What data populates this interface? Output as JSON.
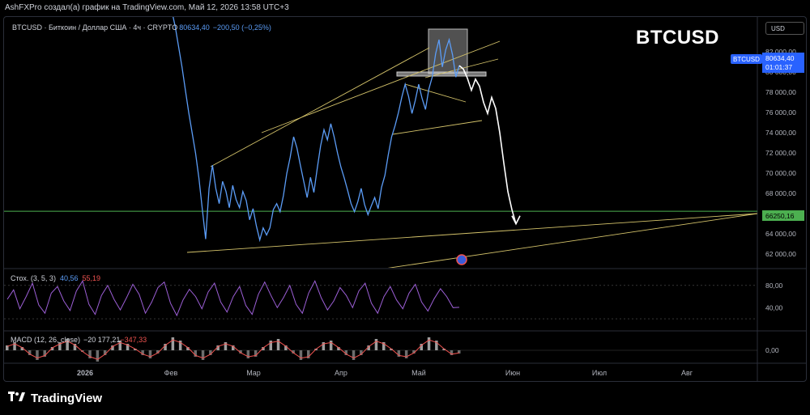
{
  "header": {
    "attribution": "AshFXPro создал(а) график на TradingView.com, Май 12, 2026 13:58 UTC+3"
  },
  "symbol": {
    "line": "BTCUSD · Биткоин / Доллар США · 4ч · CRYPTO",
    "value": "80634,40",
    "change": "−200,50 (−0,25%)",
    "big_label": "BTCUSD",
    "currency": "USD",
    "tag": "BTCUSD",
    "last_price": "80634,40",
    "countdown": "01:01:37",
    "level_label": "66250,16"
  },
  "indicators": {
    "stoch": {
      "name": "Стох. (3, 5, 3)",
      "k": "40,56",
      "d": "55,19"
    },
    "macd": {
      "name": "MACD (12, 26, close)",
      "values": "−20 177,21",
      "hist": "−347,33"
    }
  },
  "footer": {
    "brand": "TradingView"
  },
  "colors": {
    "price_line": "#5b9cf6",
    "trend_lines": "#d4c36a",
    "level": "#4caf50",
    "stoch_k": "#9c5fd6",
    "macd_hist": "#9e9e9e",
    "forecast": "#ffffff"
  },
  "chart_data": [
    {
      "type": "line",
      "title": "BTCUSD",
      "x_ticks": [
        "2026",
        "Фев",
        "Мар",
        "Апр",
        "Май",
        "Июн",
        "Июл",
        "Авг"
      ],
      "y_ticks": [
        62000,
        64000,
        66000,
        68000,
        70000,
        72000,
        74000,
        76000,
        78000,
        80000,
        82000
      ],
      "y_tick_labels": [
        "62 000,00",
        "64 000,00",
        "66 000,00",
        "68 000,00",
        "70 000,00",
        "72 000,00",
        "74 000,00",
        "76 000,00",
        "78 000,00",
        "80 000,00",
        "82 000,00"
      ],
      "ylim": [
        61300,
        84000
      ],
      "series": [
        {
          "values": [
            87800,
            86000,
            84500,
            82500,
            80500,
            78200,
            76000,
            74000,
            72000,
            69500,
            66500,
            63500,
            68500,
            70800,
            68500,
            67000,
            69200,
            68200,
            66600,
            68800,
            67400,
            66600,
            68200,
            67300,
            65400,
            66500,
            64800,
            63400,
            64600,
            63900,
            64600,
            66400,
            67000,
            66200,
            67800,
            70000,
            71600,
            73600,
            72500,
            70800,
            69200,
            67600,
            69600,
            68100,
            70500,
            72700,
            74300,
            73300,
            74900,
            73600,
            72000,
            70600,
            69500,
            68300,
            67000,
            66200,
            67200,
            68500,
            66900,
            65900,
            66800,
            67600,
            66500,
            68600,
            69800,
            71800,
            73600,
            74700,
            76000,
            77500,
            78800,
            77600,
            75900,
            77200,
            78800,
            77400,
            76300,
            78300,
            79500,
            81800,
            83200,
            80500,
            82200,
            83200,
            81700,
            79500,
            80634
          ]
        }
      ],
      "forecast": [
        80634,
        80300,
        79400,
        78200,
        79300,
        78600,
        77000,
        75900,
        77500,
        76400,
        74000,
        71000,
        68200,
        66400,
        65000
      ]
    },
    {
      "type": "line",
      "title": "Стох. (3, 5, 3)",
      "y_ticks": [
        40,
        80
      ],
      "y_tick_labels": [
        "40,00",
        "80,00"
      ],
      "ylim": [
        10,
        100
      ],
      "series": [
        {
          "name": "Стох. (3, 5, 3)",
          "values": [
            55,
            72,
            38,
            60,
            84,
            45,
            30,
            66,
            78,
            52,
            35,
            70,
            88,
            46,
            28,
            62,
            80,
            55,
            36,
            58,
            82,
            64,
            30,
            50,
            76,
            86,
            48,
            26,
            54,
            73,
            60,
            38,
            68,
            84,
            50,
            32,
            60,
            78,
            44,
            28,
            64,
            86,
            62,
            40,
            58,
            80,
            46,
            30,
            66,
            88,
            58,
            36,
            52,
            76,
            62,
            40,
            70,
            84,
            48,
            30,
            60,
            78,
            54,
            38,
            66,
            82,
            50,
            34,
            56,
            74,
            60,
            40,
            40.56
          ]
        }
      ]
    },
    {
      "type": "bar",
      "title": "MACD (12, 26, close)",
      "y_ticks": [
        0
      ],
      "y_tick_labels": [
        "0,00"
      ],
      "ylim": [
        -1,
        1
      ],
      "series": [
        {
          "name": "MACD",
          "values": [
            0.3,
            0.5,
            0.2,
            -0.3,
            -0.6,
            -0.4,
            0.2,
            0.5,
            0.7,
            0.4,
            -0.1,
            -0.5,
            -0.7,
            -0.3,
            0.3,
            0.6,
            0.4,
            0.1,
            -0.3,
            -0.5,
            -0.2,
            0.4,
            0.8,
            0.6,
            0.2,
            -0.4,
            -0.6,
            -0.3,
            0.3,
            0.5,
            0.3,
            -0.2,
            -0.5,
            -0.4,
            0.2,
            0.6,
            0.7,
            0.3,
            -0.2,
            -0.6,
            -0.5,
            0.1,
            0.5,
            0.6,
            0.2,
            -0.3,
            -0.6,
            -0.3,
            0.3,
            0.7,
            0.5,
            0.1,
            -0.4,
            -0.5,
            -0.2,
            0.4,
            0.8,
            0.6,
            0.1,
            -0.3,
            -0.2
          ]
        }
      ]
    }
  ]
}
